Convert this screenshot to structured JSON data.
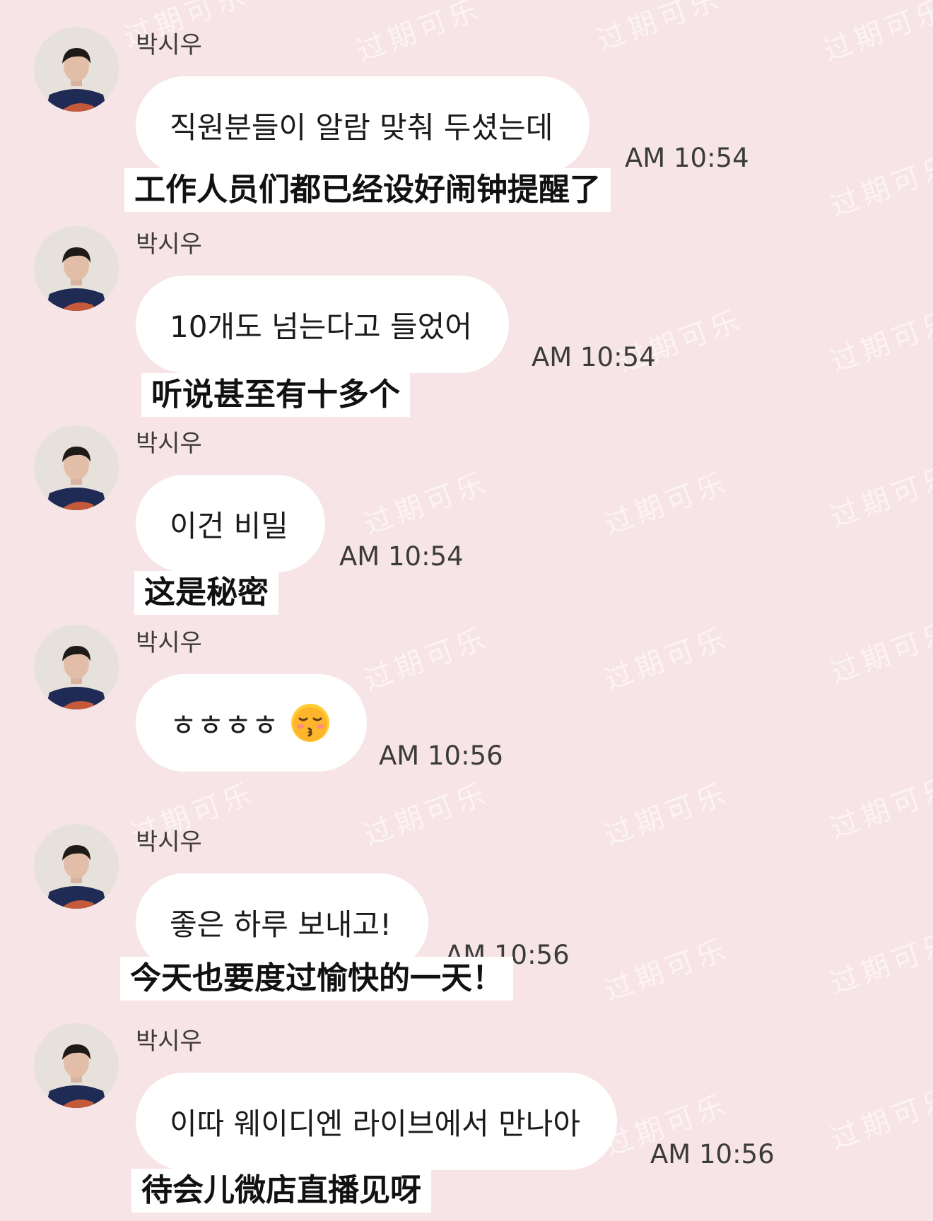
{
  "chat": {
    "messages": [
      {
        "sender": "박시우",
        "text": "직원분들이 알람 맞춰 두셨는데",
        "time": "AM 10:54",
        "caption": "工作人员们都已经设好闹钟提醒了"
      },
      {
        "sender": "박시우",
        "text": "10개도 넘는다고 들었어",
        "time": "AM 10:54",
        "caption": "听说甚至有十多个"
      },
      {
        "sender": "박시우",
        "text": "이건 비밀",
        "time": "AM 10:54",
        "caption": "这是秘密"
      },
      {
        "sender": "박시우",
        "text": "ㅎㅎㅎㅎ",
        "emoji": "kissing-face-emoji",
        "time": "AM 10:56",
        "caption": ""
      },
      {
        "sender": "박시우",
        "text": "좋은 하루 보내고!",
        "time": "AM 10:56",
        "caption": "今天也要度过愉快的一天！"
      },
      {
        "sender": "박시우",
        "text": "이따 웨이디엔 라이브에서 만나아",
        "time": "AM 10:56",
        "caption": "待会儿微店直播见呀"
      }
    ]
  },
  "watermark": {
    "text": "过期可乐"
  },
  "colors": {
    "background": "#f7e4e6",
    "bubble": "#ffffff",
    "caption_bg": "#ffffff"
  }
}
